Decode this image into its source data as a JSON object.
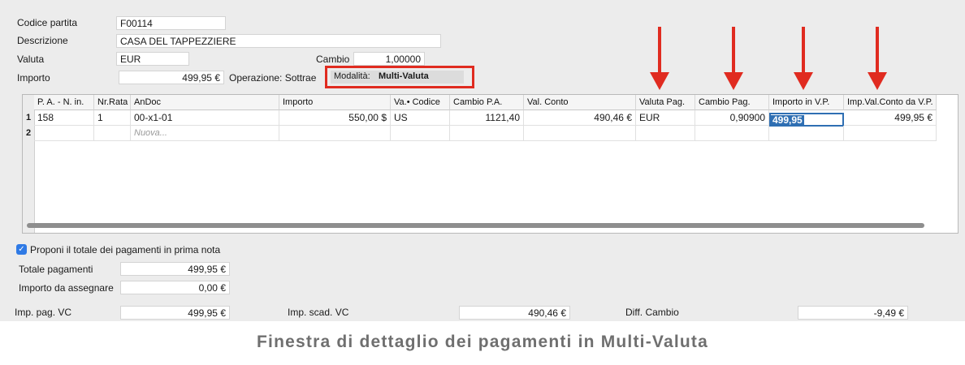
{
  "header": {
    "codice_partita_label": "Codice partita",
    "codice_partita_value": "F00114",
    "descrizione_label": "Descrizione",
    "descrizione_value": "CASA DEL TAPPEZZIERE",
    "valuta_label": "Valuta",
    "valuta_value": "EUR",
    "cambio_label": "Cambio",
    "cambio_value": "1,00000",
    "importo_label": "Importo",
    "importo_value": "499,95 €",
    "operazione_text": "Operazione: Sottrae",
    "modalita_label": "Modalità:",
    "modalita_value": "Multi-Valuta"
  },
  "grid": {
    "columns": [
      "P. A. - N. in.",
      "Nr.Rata",
      "AnDoc",
      "Importo",
      "Va.• Codice",
      "Cambio P.A.",
      "Val. Conto",
      "Valuta Pag.",
      "Cambio Pag.",
      "Importo in V.P.",
      "Imp.Val.Conto da V.P."
    ],
    "rows": [
      {
        "num": "1",
        "pa": "158",
        "nr_rata": "1",
        "andoc": "00-x1-01",
        "importo": "550,00 $",
        "valuta_codice": "US",
        "cambio_pa": "1121,40",
        "val_conto": "490,46 €",
        "valuta_pag": "EUR",
        "cambio_pag": "0,90900",
        "importo_vp": "499,95",
        "imp_val_conto_vp": "499,95 €"
      },
      {
        "num": "2",
        "andoc_placeholder": "Nuova..."
      }
    ]
  },
  "footer": {
    "checkbox_label": "Proponi il totale dei pagamenti in prima nota",
    "checkbox_checked": true,
    "totale_pagamenti_label": "Totale pagamenti",
    "totale_pagamenti_value": "499,95 €",
    "importo_assegnare_label": "Importo da assegnare",
    "importo_assegnare_value": "0,00 €",
    "imp_pag_vc_label": "Imp. pag. VC",
    "imp_pag_vc_value": "499,95 €",
    "imp_scad_vc_label": "Imp. scad. VC",
    "imp_scad_vc_value": "490,46 €",
    "diff_cambio_label": "Diff. Cambio",
    "diff_cambio_value": "-9,49 €"
  },
  "caption": "Finestra di dettaglio dei pagamenti in Multi-Valuta",
  "colors": {
    "highlight_red": "#e02b20",
    "selection_blue": "#2f6fb3",
    "panel_bg": "#ececec"
  },
  "icons": [
    "red-arrow-icon",
    "checkbox-checked-icon"
  ]
}
